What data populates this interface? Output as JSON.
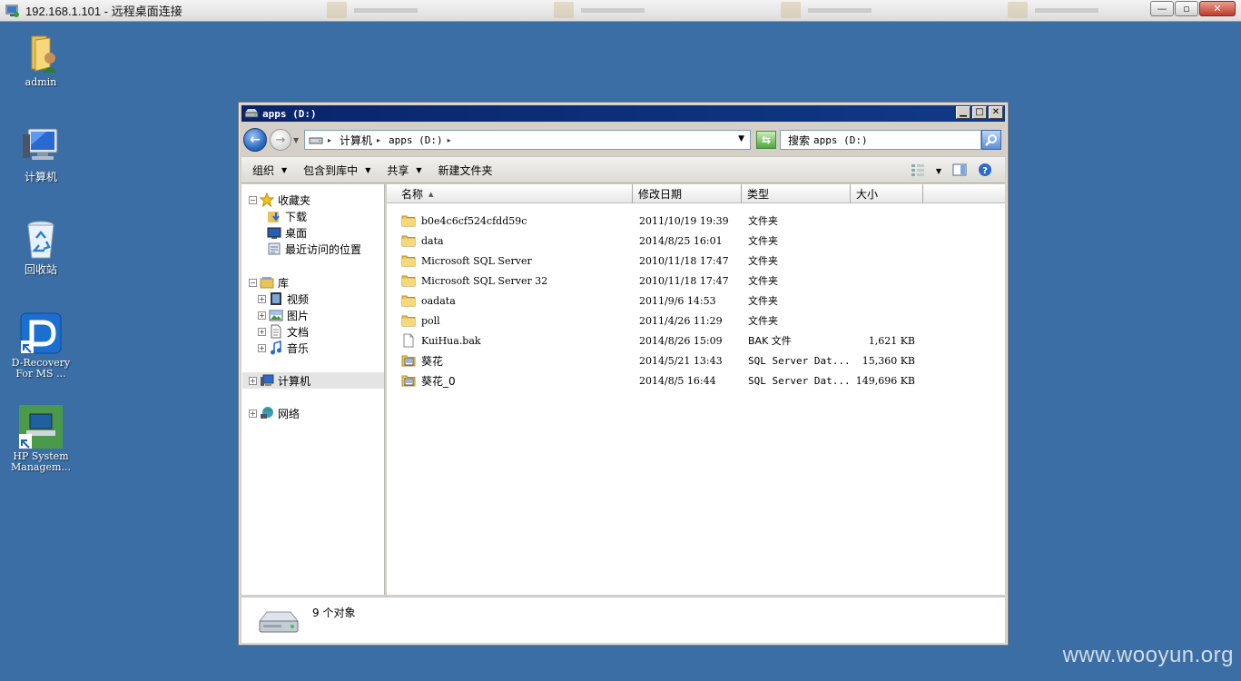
{
  "rdp": {
    "title": "192.168.1.101 - 远程桌面连接",
    "minimize": "—",
    "restore": "▫",
    "close": "✕"
  },
  "desktop": {
    "icons": [
      {
        "label": "admin"
      },
      {
        "label": "计算机"
      },
      {
        "label": "回收站"
      },
      {
        "label_line1": "D-Recovery",
        "label_line2": "For MS ..."
      },
      {
        "label_line1": "HP System",
        "label_line2": "Managem..."
      }
    ]
  },
  "window": {
    "title": "apps (D:)",
    "address": {
      "crumbs": [
        "计算机",
        "apps (D:)"
      ]
    },
    "search_placeholder_prefix": "搜索",
    "search_placeholder_target": "apps (D:)",
    "toolbar": {
      "organize": "组织",
      "include_in_library": "包含到库中",
      "share": "共享",
      "new_folder": "新建文件夹"
    },
    "nav": {
      "favorites": "收藏夹",
      "downloads": "下载",
      "desktop": "桌面",
      "recent": "最近访问的位置",
      "libraries": "库",
      "videos": "视频",
      "pictures": "图片",
      "documents": "文档",
      "music": "音乐",
      "computer": "计算机",
      "network": "网络"
    },
    "columns": {
      "name": "名称",
      "date": "修改日期",
      "type": "类型",
      "size": "大小"
    },
    "files": [
      {
        "name": "b0e4c6cf524cfdd59c",
        "date": "2011/10/19 19:39",
        "type": "文件夹",
        "size": "",
        "icon": "folder-icon"
      },
      {
        "name": "data",
        "date": "2014/8/25 16:01",
        "type": "文件夹",
        "size": "",
        "icon": "folder-icon"
      },
      {
        "name": "Microsoft SQL Server",
        "date": "2010/11/18 17:47",
        "type": "文件夹",
        "size": "",
        "icon": "folder-icon"
      },
      {
        "name": "Microsoft SQL Server 32",
        "date": "2010/11/18 17:47",
        "type": "文件夹",
        "size": "",
        "icon": "folder-icon"
      },
      {
        "name": "oadata",
        "date": "2011/9/6 14:53",
        "type": "文件夹",
        "size": "",
        "icon": "folder-icon"
      },
      {
        "name": "poll",
        "date": "2011/4/26 11:29",
        "type": "文件夹",
        "size": "",
        "icon": "folder-icon"
      },
      {
        "name": "KuiHua.bak",
        "date": "2014/8/26 15:09",
        "type": "BAK 文件",
        "size": "1,621 KB",
        "icon": "file-icon"
      },
      {
        "name": "葵花",
        "date": "2014/5/21 13:43",
        "type": "SQL Server Dat...",
        "size": "15,360 KB",
        "icon": "database-file-icon"
      },
      {
        "name": "葵花_0",
        "date": "2014/8/5 16:44",
        "type": "SQL Server Dat...",
        "size": "149,696 KB",
        "icon": "database-file-icon"
      }
    ],
    "details": {
      "count_text": "9 个对象"
    }
  },
  "watermark": "www.wooyun.org",
  "colors": {
    "desktop": "#3a6ea5",
    "titlebar": "#0a246a",
    "folder": "#e8c25a"
  }
}
